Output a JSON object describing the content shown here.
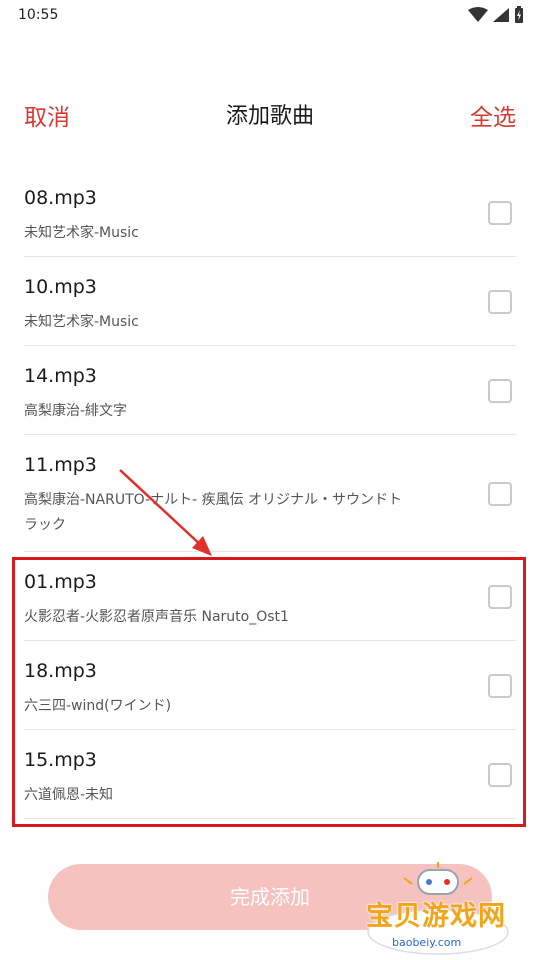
{
  "status_bar": {
    "time": "10:55"
  },
  "header": {
    "cancel_label": "取消",
    "title": "添加歌曲",
    "select_all_label": "全选"
  },
  "songs": [
    {
      "name": "08.mp3",
      "artist": "未知艺术家-Music",
      "checked": false
    },
    {
      "name": "10.mp3",
      "artist": "未知艺术家-Music",
      "checked": false
    },
    {
      "name": "14.mp3",
      "artist": "高梨康治-緋文字",
      "checked": false
    },
    {
      "name": "11.mp3",
      "artist": "高梨康治-NARUTO-ナルト- 疾風伝 オリジナル・サウンドトラック",
      "checked": false
    },
    {
      "name": "01.mp3",
      "artist": "火影忍者-火影忍者原声音乐 Naruto_Ost1",
      "checked": false
    },
    {
      "name": "18.mp3",
      "artist": "六三四-wind(ワインド)",
      "checked": false
    },
    {
      "name": "15.mp3",
      "artist": "六道佩恩-未知",
      "checked": false
    }
  ],
  "footer": {
    "done_label": "完成添加"
  },
  "watermark": {
    "text": "宝贝游戏网",
    "url": "baobeiy.com"
  },
  "colors": {
    "accent": "#d6392f",
    "annotation": "#d9191e",
    "button_disabled": "#f6c2c0"
  }
}
